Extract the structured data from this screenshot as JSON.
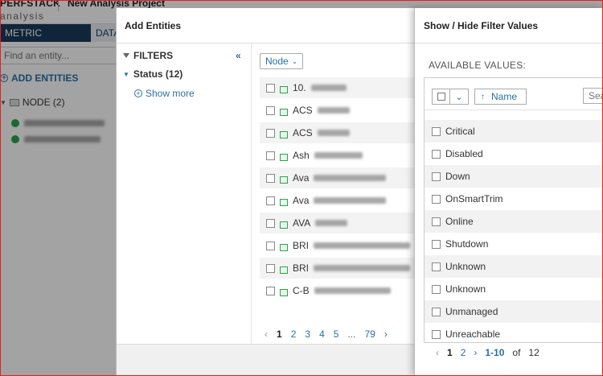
{
  "app": {
    "brand": "PERFSTACK",
    "brand_sub": "analysis",
    "project_title": "New Analysis Project",
    "tabs": [
      {
        "label": "METRIC PALETTE"
      },
      {
        "label": "DATA"
      }
    ],
    "find_placeholder": "Find an entity...",
    "add_entities_label": "ADD ENTITIES",
    "node_group_label": "NODE (2)"
  },
  "add_entities_modal": {
    "title": "Add Entities",
    "filters_label": "FILTERS",
    "collapse_icon": "«",
    "status_filter_label": "Status (12)",
    "show_more_label": "Show more",
    "type_select": "Node",
    "rows": [
      {
        "name": "10."
      },
      {
        "name": "ACS"
      },
      {
        "name": "ACS"
      },
      {
        "name": "Ash"
      },
      {
        "name": "Ava"
      },
      {
        "name": "Ava"
      },
      {
        "name": "AVA"
      },
      {
        "name": "BRI"
      },
      {
        "name": "BRI"
      },
      {
        "name": "C-B"
      }
    ],
    "pager": {
      "prev": "‹",
      "pages": [
        "1",
        "2",
        "3",
        "4",
        "5"
      ],
      "ellipsis": "...",
      "last": "79",
      "next": "›"
    }
  },
  "filter_popup": {
    "title": "Show / Hide Filter Values",
    "available_label": "AVAILABLE VALUES:",
    "sort_label": "Name",
    "search_placeholder": "Search",
    "values": [
      {
        "label": "Critical"
      },
      {
        "label": "Disabled"
      },
      {
        "label": "Down"
      },
      {
        "label": "OnSmartTrim"
      },
      {
        "label": "Online"
      },
      {
        "label": "Shutdown"
      },
      {
        "label": "Unknown"
      },
      {
        "label": "Unknown"
      },
      {
        "label": "Unmanaged"
      },
      {
        "label": "Unreachable"
      }
    ],
    "pager": {
      "prev": "‹",
      "pages": [
        "1",
        "2"
      ],
      "next": "›",
      "range": "1-10",
      "of": "of",
      "total": "12"
    }
  },
  "colors": {
    "accent": "#2a6fa8",
    "nav_dark": "#1a3a5a",
    "status_ok": "#2aa54a",
    "overlay": "rgba(0,0,0,0.36)"
  }
}
